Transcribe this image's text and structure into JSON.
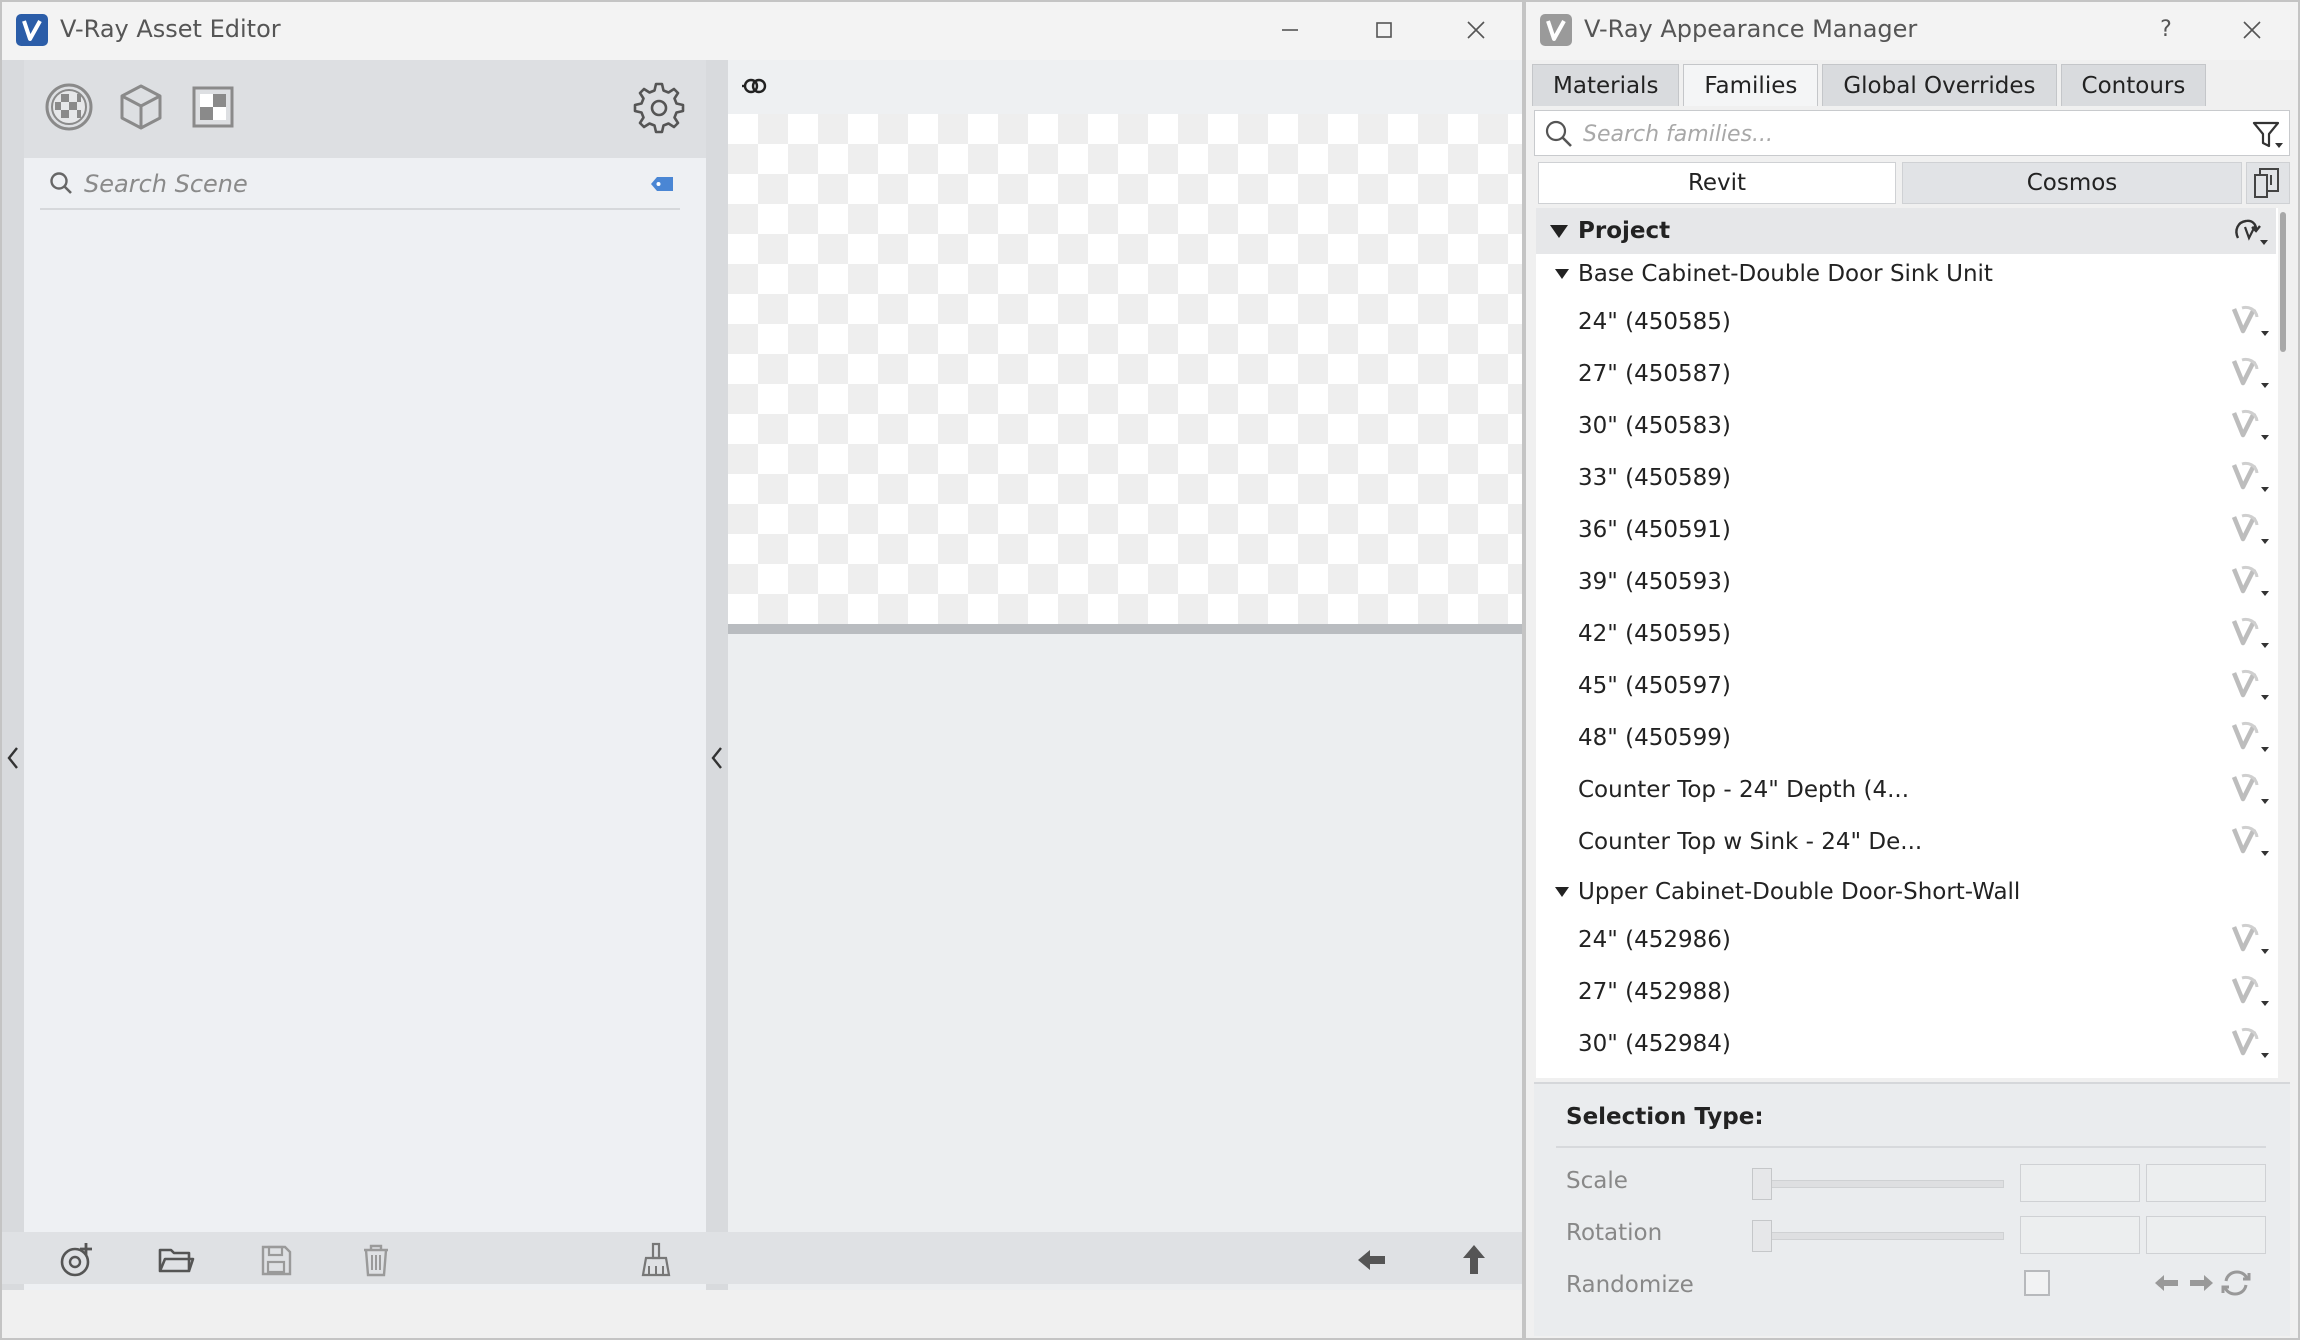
{
  "asset_editor": {
    "title": "V-Ray Asset Editor",
    "toolbar_icons": [
      "materials-icon",
      "geometry-icon",
      "textures-icon",
      "settings-icon"
    ],
    "search": {
      "placeholder": "Search Scene",
      "value": ""
    },
    "preview_icon": "preview-link-icon",
    "bottom_icons": [
      "add-asset-icon",
      "open-folder-icon",
      "save-icon",
      "delete-icon",
      "purge-icon",
      "import-arrow-icon",
      "upload-arrow-icon"
    ]
  },
  "appearance_manager": {
    "title": "V-Ray Appearance Manager",
    "help_label": "?",
    "tabs": [
      {
        "label": "Materials",
        "active": false
      },
      {
        "label": "Families",
        "active": true
      },
      {
        "label": "Global Overrides",
        "active": false
      },
      {
        "label": "Contours",
        "active": false
      }
    ],
    "search": {
      "placeholder": "Search families...",
      "value": ""
    },
    "subtabs": [
      {
        "label": "Revit",
        "active": true
      },
      {
        "label": "Cosmos",
        "active": false
      }
    ],
    "tree": {
      "root": "Project",
      "groups": [
        {
          "name": "Base Cabinet-Double Door Sink Unit",
          "items": [
            "24\" (450585)",
            "27\" (450587)",
            "30\" (450583)",
            "33\" (450589)",
            "36\" (450591)",
            "39\" (450593)",
            "42\" (450595)",
            "45\" (450597)",
            "48\" (450599)",
            "Counter Top - 24\" Depth (4...",
            "Counter Top w Sink - 24\" De..."
          ]
        },
        {
          "name": "Upper Cabinet-Double Door-Short-Wall",
          "items": [
            "24\" (452986)",
            "27\" (452988)",
            "30\" (452984)"
          ]
        }
      ]
    },
    "selection": {
      "title": "Selection Type:",
      "scale_label": "Scale",
      "rotation_label": "Rotation",
      "randomize_label": "Randomize",
      "randomize_checked": false
    }
  },
  "colors": {
    "vray_blue": "#2b5da8",
    "icon_gray": "#8a8a8a"
  }
}
